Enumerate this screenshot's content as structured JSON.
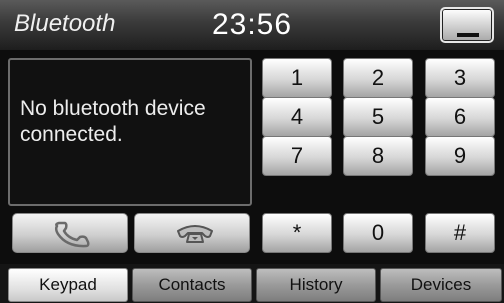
{
  "header": {
    "title": "Bluetooth",
    "clock": "23:56"
  },
  "window_controls": {
    "minimize_icon": "minimize-icon"
  },
  "display": {
    "message": "No bluetooth device connected."
  },
  "call_buttons": {
    "answer_icon": "phone-answer-icon",
    "hangup_icon": "phone-hangup-icon"
  },
  "keypad": {
    "keys": [
      "1",
      "2",
      "3",
      "4",
      "5",
      "6",
      "7",
      "8",
      "9",
      "*",
      "0",
      "#"
    ]
  },
  "tabs": [
    {
      "label": "Keypad",
      "active": true
    },
    {
      "label": "Contacts",
      "active": false
    },
    {
      "label": "History",
      "active": false
    },
    {
      "label": "Devices",
      "active": false
    }
  ],
  "colors": {
    "background": "#0d0d0d",
    "text": "#ededed",
    "button_face": "#d6d6d6"
  }
}
